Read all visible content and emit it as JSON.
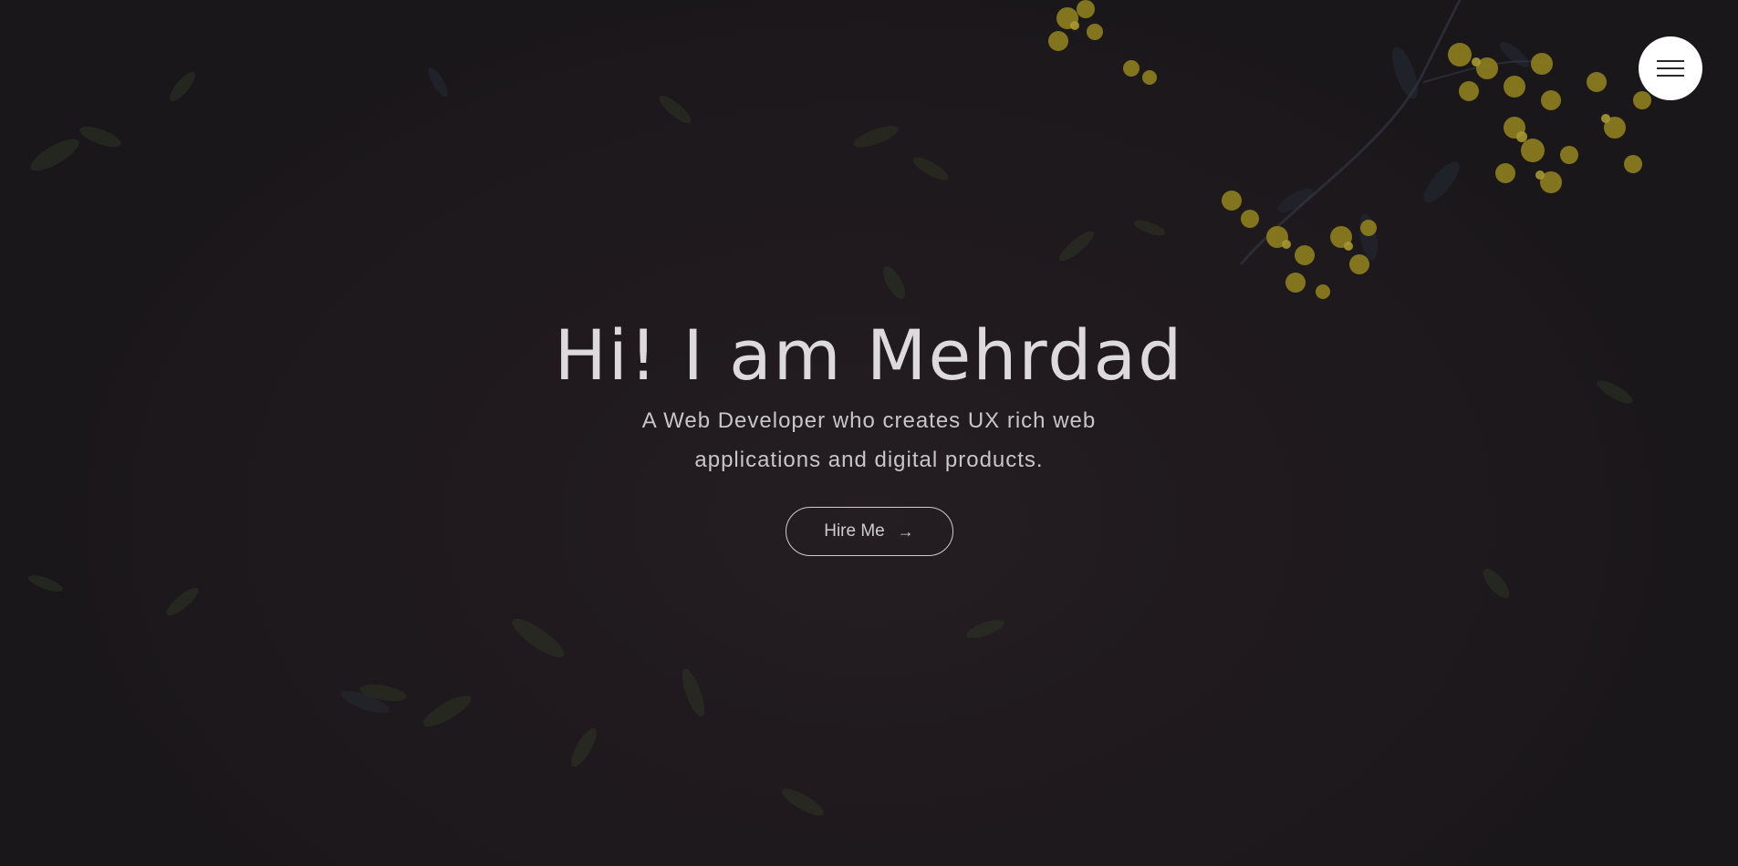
{
  "hero": {
    "headline": "Hi! I am Mehrdad",
    "subtitle_line1": "A Web Developer who creates UX rich web",
    "subtitle_line2": "applications and digital products.",
    "cta_label": "Hire Me",
    "cta_arrow": "→"
  },
  "menu": {
    "icon": "hamburger-icon"
  },
  "colors": {
    "background": "#221e22",
    "text": "#dcdadc",
    "menu_button": "#ffffff",
    "flower_accent": "#c9b52a"
  }
}
